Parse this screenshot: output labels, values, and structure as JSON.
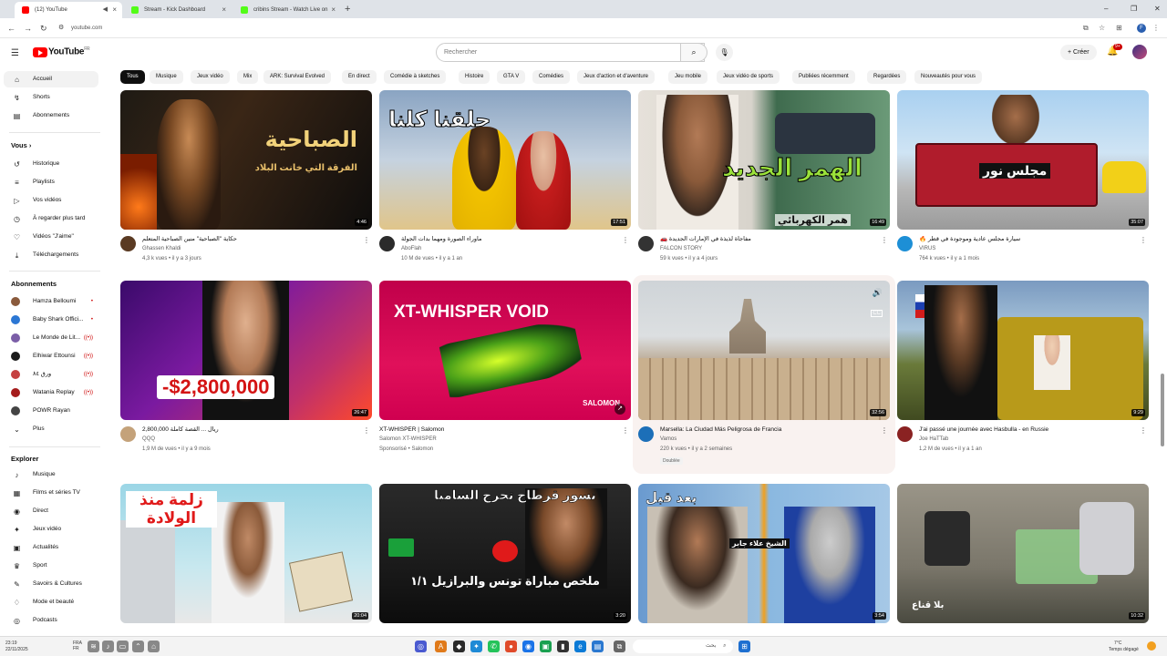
{
  "browser": {
    "tabs": [
      {
        "title": "(12) YouTube",
        "favicon_color": "#ff0000"
      },
      {
        "title": "Stream - Kick Dashboard",
        "favicon_color": "#53fc18"
      },
      {
        "title": "cribins Stream - Watch Live on",
        "favicon_color": "#53fc18"
      }
    ],
    "new_tab": "+",
    "url": "youtube.com",
    "profile_letter": "F"
  },
  "masthead": {
    "logo_text": "YouTube",
    "logo_sup": "FR",
    "search_placeholder": "Rechercher",
    "create_label": "+ Créer",
    "notif_count": "9+"
  },
  "sidebar": {
    "main": [
      {
        "label": "Accueil",
        "icon": "home-icon",
        "glyph": "⌂"
      },
      {
        "label": "Shorts",
        "icon": "shorts-icon",
        "glyph": "↯"
      },
      {
        "label": "Abonnements",
        "icon": "subscriptions-icon",
        "glyph": "▤"
      }
    ],
    "you_header": "Vous  ›",
    "you": [
      {
        "label": "Historique",
        "icon": "history-icon",
        "glyph": "↺"
      },
      {
        "label": "Playlists",
        "icon": "playlist-icon",
        "glyph": "≡"
      },
      {
        "label": "Vos vidéos",
        "icon": "your-videos-icon",
        "glyph": "▷"
      },
      {
        "label": "À regarder plus tard",
        "icon": "clock-icon",
        "glyph": "◷"
      },
      {
        "label": "Vidéos \"J'aime\"",
        "icon": "like-icon",
        "glyph": "♡"
      },
      {
        "label": "Téléchargements",
        "icon": "download-icon",
        "glyph": "⤓"
      }
    ],
    "subs_header": "Abonnements",
    "subs": [
      {
        "label": "Hamza Belloumi",
        "color": "#8a5a3c"
      },
      {
        "label": "Baby Shark Offici...",
        "color": "#2c77d4"
      },
      {
        "label": "Le Monde de Lit...",
        "color": "#7b5ea7"
      },
      {
        "label": "Elhiwar Ettounsi",
        "color": "#1b1b1b"
      },
      {
        "label": "ورق ٨٤",
        "color": "#c54141"
      },
      {
        "label": "Watania Replay",
        "color": "#a51c1c"
      },
      {
        "label": "POWR Rayan",
        "color": "#444444"
      },
      {
        "label": "Plus",
        "color": ""
      }
    ],
    "explore_header": "Explorer",
    "explore": [
      {
        "label": "Musique",
        "icon": "music-icon",
        "glyph": "♪"
      },
      {
        "label": "Films et séries TV",
        "icon": "film-icon",
        "glyph": "▦"
      },
      {
        "label": "Direct",
        "icon": "live-icon",
        "glyph": "◉"
      },
      {
        "label": "Jeux vidéo",
        "icon": "gaming-icon",
        "glyph": "✦"
      },
      {
        "label": "Actualités",
        "icon": "news-icon",
        "glyph": "▣"
      },
      {
        "label": "Sport",
        "icon": "trophy-icon",
        "glyph": "♛"
      },
      {
        "label": "Savoirs & Cultures",
        "icon": "learning-icon",
        "glyph": "✎"
      },
      {
        "label": "Mode et beauté",
        "icon": "fashion-icon",
        "glyph": "♢"
      },
      {
        "label": "Podcasts",
        "icon": "podcast-icon",
        "glyph": "◎"
      }
    ]
  },
  "chips": [
    "Tous",
    "Musique",
    "Jeux vidéo",
    "Mix",
    "ARK: Survival Evolved",
    "En direct",
    "Comédie à sketches",
    "Histoire",
    "GTA V",
    "Comédies",
    "Jeux d'action et d'aventure",
    "Jeu mobile",
    "Jeux vidéo de sports",
    "Publiées récemment",
    "Regardées",
    "Nouveautés pour vous"
  ],
  "videos": [
    {
      "title": "حكاية \"الصباحية\" منين الصباحية المتعلم",
      "channel": "Ghassen Khaldi",
      "meta": "4,3 k vues • il y a 3 jours",
      "duration": "4:46",
      "thumb_text": "الصباحية",
      "thumb_sub": "الفرقة التي خانت البلاد"
    },
    {
      "title": "ماوراء الصورة ومهما بدأت الجولة",
      "channel": "AboFlah",
      "meta": "10 M de vues • il y a 1 an",
      "duration": "17:51",
      "thumb_text": "حلقنا  كلنا",
      "thumb_sub": ""
    },
    {
      "title": "🚗 مفاجأة لذيذة في الإمارات الجديدة",
      "channel": "FALCON STORY",
      "meta": "59 k vues • il y a 4 jours",
      "duration": "16:49",
      "thumb_text": "الهمر الجديد",
      "thumb_sub": "همر الكهربائي"
    },
    {
      "title": "🔥 سيارة مجلس عادية وموجودة في قطر",
      "channel": "VIRUS",
      "meta": "764 k vues • il y a 1 mois",
      "duration": "35:07",
      "thumb_text": "مجلس نور",
      "thumb_sub": ""
    },
    {
      "title": "2,800,000 ريال ... القصة كاملة",
      "channel": "QQQ",
      "meta": "1,9 M de vues • il y a 9 mois",
      "duration": "26:47",
      "thumb_text": "-$2,800,000",
      "thumb_sub": ""
    },
    {
      "title": "XT-WHISPER | Salomon",
      "channel": "Salomon XT-WHISPER",
      "meta": "Sponsorisé • Salomon",
      "duration": "",
      "thumb_text": "XT-WHISPER VOID",
      "thumb_sub": "SALOMON"
    },
    {
      "title": "Marsella: La Ciudad Más Peligrosa de Francia",
      "channel": "Vamos",
      "meta": "220 k vues • il y a 2 semaines",
      "duration": "32:56",
      "thumb_text": "",
      "thumb_sub": "",
      "badge": "Doublée"
    },
    {
      "title": "J'ai passé une journée avec Hasbulla - en Russie",
      "channel": "Joe HaTTab",
      "meta": "1,2 M de vues • il y a 1 an",
      "duration": "9:29",
      "thumb_text": "",
      "thumb_sub": ""
    },
    {
      "title": "",
      "channel": "",
      "meta": "",
      "duration": "20:04",
      "thumb_text": "زلمة منذ الولادة",
      "thumb_sub": ""
    },
    {
      "title": "",
      "channel": "",
      "meta": "",
      "duration": "3:20",
      "thumb_text": "نسور قرطاج تحرج السامبا",
      "thumb_sub": "ملخص مباراة تونس والبرازيل ١/١"
    },
    {
      "title": "",
      "channel": "",
      "meta": "",
      "duration": "3:54",
      "thumb_text": "بعد   قبل",
      "thumb_sub": "الشيخ علاء جابر"
    },
    {
      "title": "",
      "channel": "",
      "meta": "",
      "duration": "10:32",
      "thumb_text": "بلا قناع",
      "thumb_sub": ""
    }
  ],
  "taskbar": {
    "time": "23:19",
    "date": "22/11/2025",
    "lang": "FRA\nFR",
    "search": "بحث",
    "weather": "7°C",
    "weather_desc": "Temps dégagé"
  }
}
